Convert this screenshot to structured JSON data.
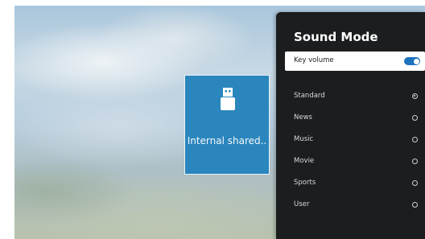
{
  "storage_tile": {
    "label": "Internal shared..",
    "icon": "usb-drive-icon"
  },
  "sound_mode": {
    "title": "Sound Mode",
    "key_volume": {
      "label": "Key volume",
      "enabled": true
    },
    "options": [
      {
        "label": "Standard",
        "selected": true
      },
      {
        "label": "News",
        "selected": false
      },
      {
        "label": "Music",
        "selected": false
      },
      {
        "label": "Movie",
        "selected": false
      },
      {
        "label": "Sports",
        "selected": false
      },
      {
        "label": "User",
        "selected": false
      }
    ]
  },
  "colors": {
    "tile_blue": "#2a86bd",
    "panel_bg": "#1b1d1f",
    "toggle_accent": "#1e73be"
  }
}
